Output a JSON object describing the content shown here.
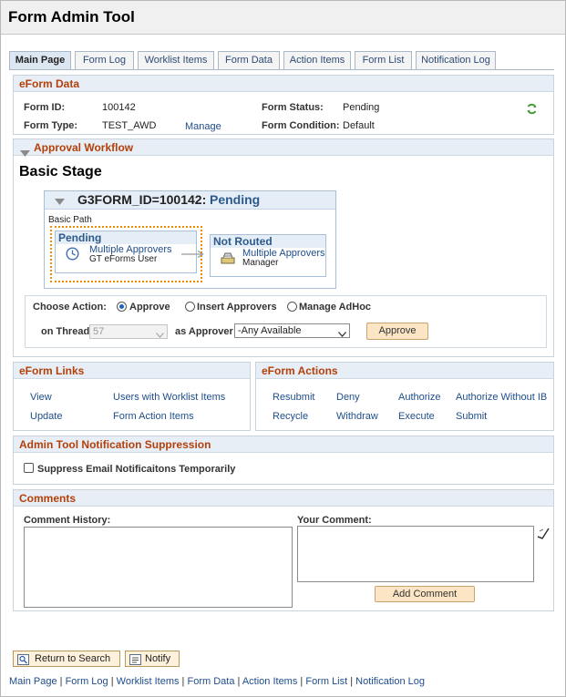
{
  "app": {
    "title": "Form Admin Tool"
  },
  "tabs": [
    {
      "label": "Main Page",
      "active": true
    },
    {
      "label": "Form Log"
    },
    {
      "label": "Worklist Items"
    },
    {
      "label": "Form Data"
    },
    {
      "label": "Action Items"
    },
    {
      "label": "Form List"
    },
    {
      "label": "Notification Log"
    }
  ],
  "eform_data": {
    "header": "eForm Data",
    "form_id_label": "Form ID:",
    "form_id": "100142",
    "form_type_label": "Form Type:",
    "form_type": "TEST_AWD",
    "manage_link": "Manage",
    "status_label": "Form Status:",
    "status": "Pending",
    "condition_label": "Form Condition:",
    "condition": "Default",
    "refresh_icon": "refresh-icon"
  },
  "workflow": {
    "header": "Approval Workflow",
    "stage_title": "Basic Stage",
    "box_title_id": "G3FORM_ID=100142:",
    "box_title_status": "Pending",
    "path_label": "Basic Path",
    "step1": {
      "status": "Pending",
      "link": "Multiple Approvers",
      "user": "GT eForms User"
    },
    "step2": {
      "status": "Not Routed",
      "link": "Multiple Approvers",
      "user": "Manager"
    },
    "choose_action_label": "Choose Action:",
    "actions": [
      "Approve",
      "Insert Approvers",
      "Manage AdHoc"
    ],
    "selected_action": "Approve",
    "thread_label": "on Thread",
    "thread_value": "57",
    "approver_label": "as Approver",
    "approver_value": "-Any Available",
    "approve_button": "Approve"
  },
  "links": {
    "header": "eForm Links",
    "items": [
      "View",
      "Users with Worklist Items",
      "Update",
      "Form Action Items"
    ]
  },
  "actions_box": {
    "header": "eForm Actions",
    "items": [
      "Resubmit",
      "Deny",
      "Authorize",
      "Authorize Without IB",
      "Recycle",
      "Withdraw",
      "Execute",
      "Submit"
    ]
  },
  "suppression": {
    "header": "Admin Tool Notification Suppression",
    "checkbox_label": "Suppress Email Notificaitons Temporarily"
  },
  "comments": {
    "header": "Comments",
    "history_label": "Comment History:",
    "your_label": "Your Comment:",
    "add_button": "Add Comment"
  },
  "bottom": {
    "return_button": "Return to Search",
    "notify_button": "Notify",
    "footer_links": [
      "Main Page",
      "Form Log",
      "Worklist Items",
      "Form Data",
      "Action Items",
      "Form List",
      "Notification Log"
    ],
    "separator": " | "
  }
}
